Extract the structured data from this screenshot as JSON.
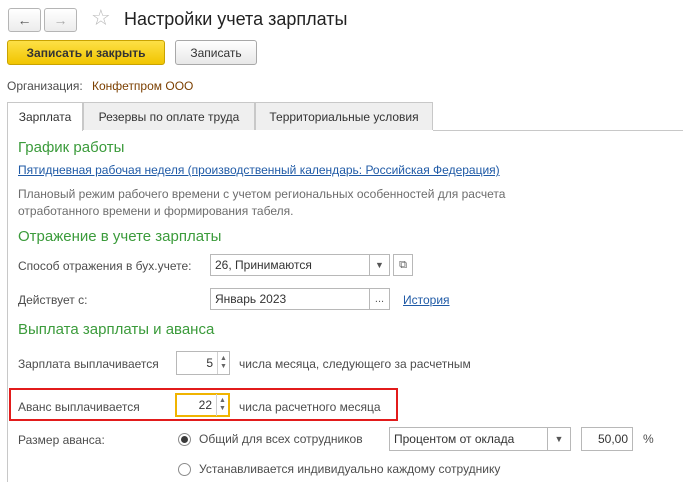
{
  "window": {
    "title": "Настройки учета зарплаты"
  },
  "toolbar": {
    "save_close_label": "Записать и закрыть",
    "save_label": "Записать"
  },
  "organization": {
    "label": "Организация:",
    "value": "Конфетпром ООО"
  },
  "tabs": [
    {
      "label": "Зарплата",
      "active": true
    },
    {
      "label": "Резервы по оплате труда",
      "active": false
    },
    {
      "label": "Территориальные условия",
      "active": false
    }
  ],
  "schedule": {
    "heading": "График работы",
    "link": "Пятидневная рабочая неделя (производственный календарь: Российская Федерация)",
    "note_line1": "Плановый режим рабочего времени с учетом региональных особенностей для расчета",
    "note_line2": "отработанного времени и формирования табеля."
  },
  "accounting": {
    "heading": "Отражение в учете зарплаты",
    "method_label": "Способ отражения в бух.учете:",
    "method_value": "26, Принимаются",
    "effective_label": "Действует с:",
    "effective_value": "Январь 2023",
    "history_link": "История"
  },
  "payment": {
    "heading": "Выплата зарплаты и аванса",
    "salary_label": "Зарплата выплачивается",
    "salary_day": "5",
    "salary_suffix": "числа месяца, следующего за расчетным",
    "advance_label": "Аванс выплачивается",
    "advance_day": "22",
    "advance_suffix": "числа расчетного месяца",
    "advance_size_label": "Размер аванса:",
    "option_common": "Общий для всех сотрудников",
    "option_common_selected": true,
    "method_select": "Процентом от оклада",
    "percent_value": "50,00",
    "percent_unit": "%",
    "option_individual": "Устанавливается индивидуально каждому сотруднику"
  },
  "colors": {
    "section": "#3b9b3b",
    "link": "#1f5aa6",
    "primary_button": "#f5cd14",
    "highlight": "#e21b1b",
    "org_value": "#7b3f00"
  }
}
